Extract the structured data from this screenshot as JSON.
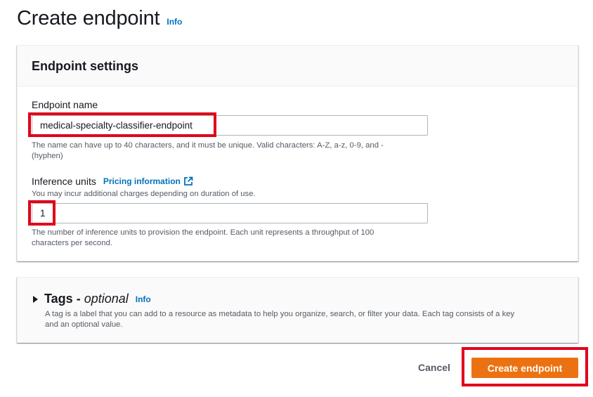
{
  "page": {
    "title": "Create endpoint",
    "info_label": "Info"
  },
  "settings": {
    "heading": "Endpoint settings",
    "endpoint_name": {
      "label": "Endpoint name",
      "value": "medical-specialty-classifier-endpoint",
      "description_line1": "The name can have up to 40 characters, and it must be unique. Valid characters: A-Z, a-z, 0-9, and -",
      "description_line2": "(hyphen)"
    },
    "inference_units": {
      "label": "Inference units",
      "pricing_link": "Pricing information",
      "hint": "You may incur additional charges depending on duration of use.",
      "value": "1",
      "description_line1": "The number of inference units to provision the endpoint. Each unit represents a throughput of 100",
      "description_line2": "characters per second."
    }
  },
  "tags": {
    "title": "Tags",
    "dash": "-",
    "optional": "optional",
    "info_label": "Info",
    "description_line1": "A tag is a label that you can add to a resource as metadata to help you organize, search, or filter your data. Each tag consists of a key",
    "description_line2": "and an optional value."
  },
  "actions": {
    "cancel_label": "Cancel",
    "create_label": "Create endpoint"
  },
  "colors": {
    "primary_button": "#ec7211",
    "link": "#0073bb",
    "highlight": "#e2001a"
  },
  "icons": {
    "external_link": "external-link-icon",
    "caret": "caret-right-icon"
  }
}
